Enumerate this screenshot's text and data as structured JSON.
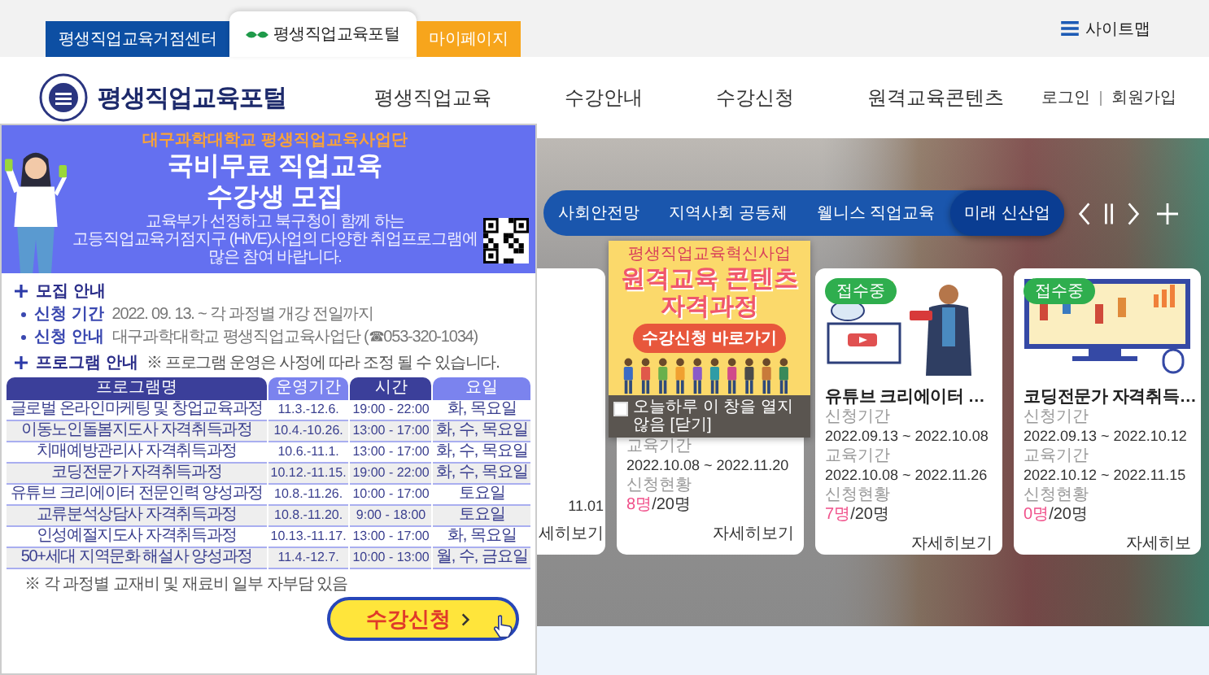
{
  "top_tabs": [
    {
      "label": "평생직업교육거점센터",
      "selected": false,
      "color": "#0d4fa3"
    },
    {
      "label": "평생직업교육포털",
      "selected": true,
      "color": "#ffffff"
    },
    {
      "label": "마이페이지",
      "selected": false,
      "color": "#f7a51c"
    }
  ],
  "sitemap": {
    "label": "사이트맵"
  },
  "header": {
    "logo_text": "평생직업교육포털",
    "nav": [
      "평생직업교육",
      "수강안내",
      "수강신청",
      "원격교육콘텐츠"
    ],
    "user_links": [
      "로그인",
      "회원가입"
    ]
  },
  "hero": {
    "categories": [
      {
        "label": "사회안전망",
        "selected": false
      },
      {
        "label": "지역사회 공동체",
        "selected": false
      },
      {
        "label": "웰니스 직업교육",
        "selected": false
      },
      {
        "label": "미래 신산업",
        "selected": true
      }
    ],
    "cards": [
      {
        "kind": "partial",
        "info": [
          {
            "value": "11.01"
          }
        ],
        "more": "세히보기"
      },
      {
        "kind": "covered",
        "info": [
          {
            "label": "교육기간",
            "value": "2022.10.08 ~ 2022.11.20"
          },
          {
            "label": "신청현황",
            "count": "8명",
            "total": "/20명"
          }
        ],
        "more": "자세히보기"
      },
      {
        "kind": "course",
        "badge": "접수중",
        "title": "유튜브 크리에이터 …",
        "info": [
          {
            "label": "신청기간",
            "value": "2022.09.13 ~ 2022.10.08"
          },
          {
            "label": "교육기간",
            "value": "2022.10.08 ~ 2022.11.26"
          },
          {
            "label": "신청현황",
            "count": "7명",
            "total": "/20명"
          }
        ],
        "more": "자세히보기"
      },
      {
        "kind": "course",
        "badge": "접수중",
        "title": "코딩전문가 자격취득…",
        "info": [
          {
            "label": "신청기간",
            "value": "2022.09.13 ~ 2022.10.12"
          },
          {
            "label": "교육기간",
            "value": "2022.10.12 ~ 2022.11.15"
          },
          {
            "label": "신청현황",
            "count": "0명",
            "total": "/20명"
          }
        ],
        "more": "자세히보"
      }
    ]
  },
  "banner_popup": {
    "kicker": "평생직업교육혁신사업",
    "title_lines": [
      "원격교육 콘텐츠",
      "자격과정"
    ],
    "cta": "수강신청 바로가기",
    "dismiss": {
      "label": "오늘하루 이 창을 열지 않음 [닫기]",
      "checked": false
    }
  },
  "left_popup": {
    "org": "대구과학대학교 평생직업교육사업단",
    "title_lines": [
      "국비무료 직업교육",
      "수강생 모집"
    ],
    "intro_lines": [
      "교육부가 선정하고 북구청이 함께 하는",
      "고등직업교육거점지구 (HiVE)사업의 다양한 취업프로그램에",
      "많은 참여 바랍니다."
    ],
    "recruit": {
      "heading": "모집 안내",
      "items": [
        {
          "label": "신청 기간",
          "value": "2022. 09. 13. ~ 각 과정별 개강 전일까지"
        },
        {
          "label": "신청 안내",
          "value": "대구과학대학교 평생직업교육사업단 (☎053-320-1034)"
        }
      ]
    },
    "program": {
      "heading": "프로그램 안내",
      "note": "※ 프로그램 운영은 사정에 따라 조정 될 수 있습니다.",
      "columns": [
        "프로그램명",
        "운영기간",
        "시간",
        "요일"
      ],
      "rows": [
        [
          "글로벌 온라인마케팅 및 창업교육과정",
          "11.3.-12.6.",
          "19:00 - 22:00",
          "화, 목요일"
        ],
        [
          "이동노인돌봄지도사 자격취득과정",
          "10.4.-10.26.",
          "13:00 - 17:00",
          "화, 수, 목요일"
        ],
        [
          "치매예방관리사 자격취득과정",
          "10.6.-11.1.",
          "13:00 - 17:00",
          "화, 수, 목요일"
        ],
        [
          "코딩전문가 자격취득과정",
          "10.12.-11.15.",
          "19:00 - 22:00",
          "화, 수, 목요일"
        ],
        [
          "유튜브 크리에이터 전문인력 양성과정",
          "10.8.-11.26.",
          "10:00 - 17:00",
          "토요일"
        ],
        [
          "교류분석상담사 자격취득과정",
          "10.8.-11.20.",
          "9:00 - 18:00",
          "토요일"
        ],
        [
          "인성예절지도사 자격취득과정",
          "10.13.-11.17.",
          "13:00 - 17:00",
          "화, 목요일"
        ],
        [
          "50+세대 지역문화 해설사 양성과정",
          "11.4.-12.7.",
          "10:00 - 13:00",
          "월, 수, 금요일"
        ]
      ],
      "footnote": "※ 각 과정별 교재비 및 재료비 일부 자부담 있음"
    },
    "apply_button": "수강신청"
  }
}
